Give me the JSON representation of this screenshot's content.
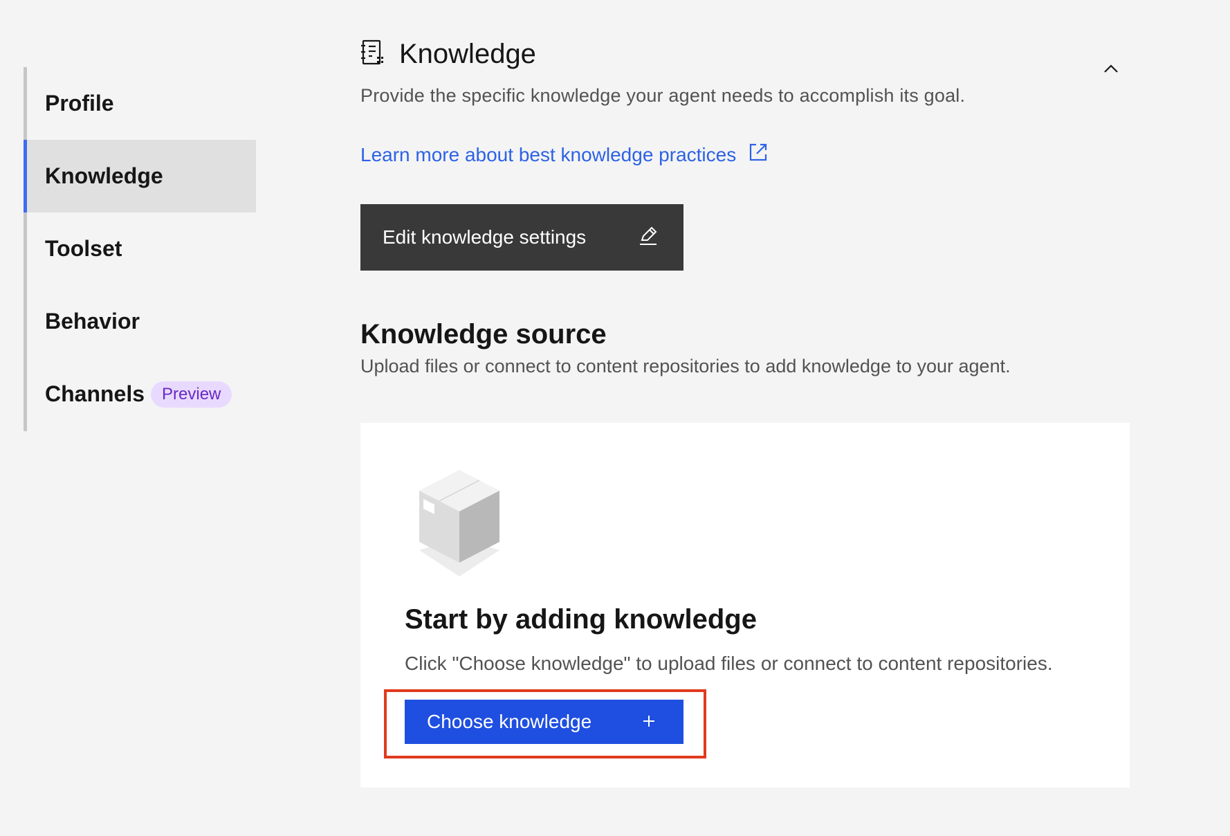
{
  "sidebar": {
    "items": [
      {
        "label": "Profile"
      },
      {
        "label": "Knowledge",
        "active": true
      },
      {
        "label": "Toolset"
      },
      {
        "label": "Behavior"
      },
      {
        "label": "Channels",
        "tag": "Preview"
      }
    ]
  },
  "section": {
    "title": "Knowledge",
    "description": "Provide the specific knowledge your agent needs to accomplish its goal.",
    "learn_link": "Learn more about best knowledge practices",
    "edit_button": "Edit knowledge settings",
    "icon": "document-list-icon",
    "collapse_icon": "chevron-up-icon"
  },
  "knowledge_source": {
    "title": "Knowledge source",
    "description": "Upload files or connect to content repositories to add knowledge to your agent."
  },
  "empty_state": {
    "title": "Start by adding knowledge",
    "description": "Click \"Choose knowledge\" to upload files or connect to content repositories.",
    "button": "Choose knowledge",
    "button_icon": "plus-icon",
    "illustration": "box-icon"
  },
  "colors": {
    "accent": "#3d6cf0",
    "primary_button": "#1f4fe0",
    "link": "#2d62e6",
    "highlight": "#e03a1e",
    "tag_bg": "#e8daff",
    "tag_text": "#6929c4"
  }
}
